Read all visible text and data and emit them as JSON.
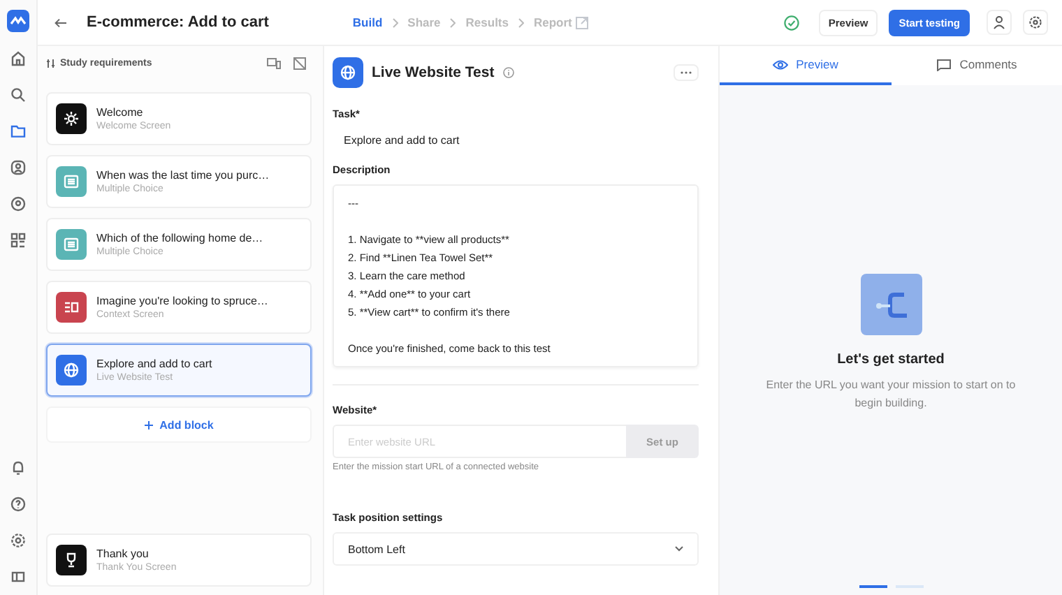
{
  "rail": {
    "top": [
      {
        "selected": false
      },
      {
        "selected": false
      },
      {
        "selected": true
      },
      {
        "selected": false
      },
      {
        "selected": false
      },
      {
        "selected": false
      }
    ],
    "bottom": [
      {
        "selected": false
      },
      {
        "selected": false
      },
      {
        "selected": false
      },
      {
        "selected": false
      }
    ]
  },
  "header": {
    "title": "E-commerce: Add to cart",
    "steps": [
      {
        "label": "Build",
        "selected": true
      },
      {
        "label": "Share",
        "selected": false
      },
      {
        "label": "Results",
        "selected": false
      },
      {
        "label": "Report",
        "selected": false
      }
    ],
    "preview_button": "Preview",
    "start_button": "Start testing"
  },
  "sidebar": {
    "requirements": "Study requirements",
    "blocks": [
      {
        "kind": "welcome",
        "title": "Welcome",
        "subtitle": "Welcome Screen",
        "selected": false
      },
      {
        "kind": "choice",
        "title": "When was the last time you purc…",
        "subtitle": "Multiple Choice",
        "selected": false
      },
      {
        "kind": "choice",
        "title": "Which of the following home de…",
        "subtitle": "Multiple Choice",
        "selected": false
      },
      {
        "kind": "context",
        "title": "Imagine you're looking to spruce…",
        "subtitle": "Context Screen",
        "selected": false
      },
      {
        "kind": "website",
        "title": "Explore and add to cart",
        "subtitle": "Live Website Test",
        "selected": true
      }
    ],
    "add_block": "Add block",
    "end_block": {
      "kind": "thanks",
      "title": "Thank you",
      "subtitle": "Thank You Screen",
      "selected": false
    }
  },
  "editor": {
    "title": "Live Website Test",
    "task_label": "Task*",
    "task_value": "Explore and add to cart",
    "description_label": "Description",
    "description_paragraphs": [
      [
        "---"
      ],
      [
        "1. Navigate to **view all products**",
        "2. Find **Linen Tea Towel Set**",
        "3. Learn the care method",
        "4. **Add one** to your cart",
        "5. **View cart** to confirm it's there"
      ],
      [
        "Once you're finished, come back to this test"
      ]
    ],
    "website_label": "Website*",
    "website_placeholder": "Enter website URL",
    "setup_button": "Set up",
    "website_hint": "Enter the mission start URL of a connected website",
    "position_label": "Task position settings",
    "position_value": "Bottom Left"
  },
  "preview": {
    "tabs": [
      {
        "label": "Preview",
        "kind": "preview",
        "selected": true
      },
      {
        "label": "Comments",
        "kind": "comments",
        "selected": false
      }
    ],
    "heading": "Let's get started",
    "text": "Enter the URL you want your mission to start on to begin building.",
    "pages": [
      {
        "selected": true
      },
      {
        "selected": false
      }
    ]
  }
}
